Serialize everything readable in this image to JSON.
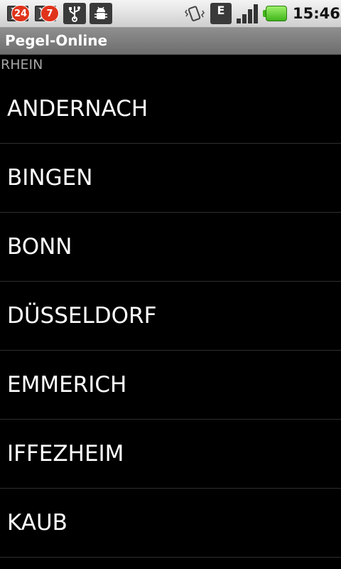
{
  "status_bar": {
    "notifications": [
      {
        "icon": "mail-notification-icon",
        "count": "24"
      },
      {
        "icon": "mail-notification-icon",
        "count": "7"
      }
    ],
    "icons": [
      "usb-icon",
      "android-debug-icon",
      "vibrate-icon",
      "edge-network-icon",
      "signal-icon",
      "battery-icon"
    ],
    "network_label": "E",
    "time": "15:46",
    "colors": {
      "background": "#e2e2e2",
      "badge": "#e0331b",
      "battery": "#3fb51a"
    }
  },
  "app": {
    "title": "Pegel-Online"
  },
  "section": {
    "header": "RHEIN"
  },
  "stations": [
    {
      "name": "ANDERNACH"
    },
    {
      "name": "BINGEN"
    },
    {
      "name": "BONN"
    },
    {
      "name": "DÜSSELDORF"
    },
    {
      "name": "EMMERICH"
    },
    {
      "name": "IFFEZHEIM"
    },
    {
      "name": "KAUB"
    }
  ]
}
